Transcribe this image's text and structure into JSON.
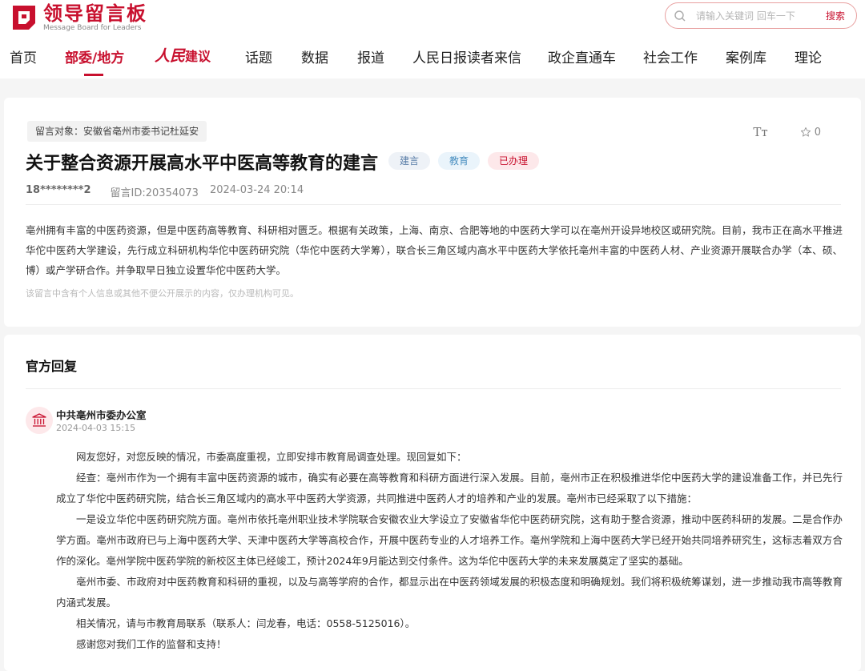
{
  "brand": {
    "name_cn": "领导留言板",
    "name_en": "Message Board for Leaders",
    "accent": "#c8102e"
  },
  "search": {
    "placeholder": "请输入关键词 回车一下",
    "button": "搜索"
  },
  "nav": {
    "items": [
      {
        "label": "首页"
      },
      {
        "label": "部委/地方",
        "active": true
      },
      {
        "label": "人民",
        "suffix": "建议"
      },
      {
        "label": "话题"
      },
      {
        "label": "数据"
      },
      {
        "label": "报道"
      },
      {
        "label": "人民日报读者来信"
      },
      {
        "label": "政企直通车"
      },
      {
        "label": "社会工作"
      },
      {
        "label": "案例库"
      },
      {
        "label": "理论"
      }
    ]
  },
  "message": {
    "target": "留言对象：安徽省亳州市委书记杜延安",
    "font_tool": "Tт",
    "star_count": "0",
    "title": "关于整合资源开展高水平中医高等教育的建言",
    "tags": [
      "建言",
      "教育",
      "已办理"
    ],
    "user": "18********2",
    "id": "留言ID:20354073",
    "time": "2024-03-24 20:14",
    "body": "亳州拥有丰富的中医药资源，但是中医药高等教育、科研相对匮乏。根据有关政策，上海、南京、合肥等地的中医药大学可以在亳州开设异地校区或研究院。目前，我市正在高水平推进华佗中医药大学建设，先行成立科研机构华佗中医药研究院（华佗中医药大学筹），联合长三角区域内高水平中医药大学依托亳州丰富的中医药人材、产业资源开展联合办学（本、硕、博）或产学研合作。并争取早日独立设置华佗中医药大学。",
    "privacy_note": "该留言中含有个人信息或其他不便公开展示的内容，仅办理机构可见。"
  },
  "reply": {
    "heading": "官方回复",
    "org": "中共亳州市委办公室",
    "time": "2024-04-03 15:15",
    "paragraphs": [
      "网友您好，对您反映的情况，市委高度重视，立即安排市教育局调查处理。现回复如下：",
      "经查：亳州市作为一个拥有丰富中医药资源的城市，确实有必要在高等教育和科研方面进行深入发展。目前，亳州市正在积极推进华佗中医药大学的建设准备工作，并已先行成立了华佗中医药研究院，结合长三角区域内的高水平中医药大学资源，共同推进中医药人才的培养和产业的发展。亳州市已经采取了以下措施：",
      "一是设立华佗中医药研究院方面。亳州市依托亳州职业技术学院联合安徽农业大学设立了安徽省华佗中医药研究院，这有助于整合资源，推动中医药科研的发展。二是合作办学方面。亳州市政府已与上海中医药大学、天津中医药大学等高校合作，开展中医药专业的人才培养工作。亳州学院和上海中医药大学已经开始共同培养研究生，这标志着双方合作的深化。亳州学院中医药学院的新校区主体已经竣工，预计2024年9月能达到交付条件。这为华佗中医药大学的未来发展奠定了坚实的基础。",
      "亳州市委、市政府对中医药教育和科研的重视，以及与高等学府的合作，都显示出在中医药领域发展的积极态度和明确规划。我们将积极统筹谋划，进一步推动我市高等教育内涵式发展。",
      "相关情况，请与市教育局联系（联系人：闫龙春，电话：0558-5125016）。",
      "感谢您对我们工作的监督和支持！"
    ]
  }
}
